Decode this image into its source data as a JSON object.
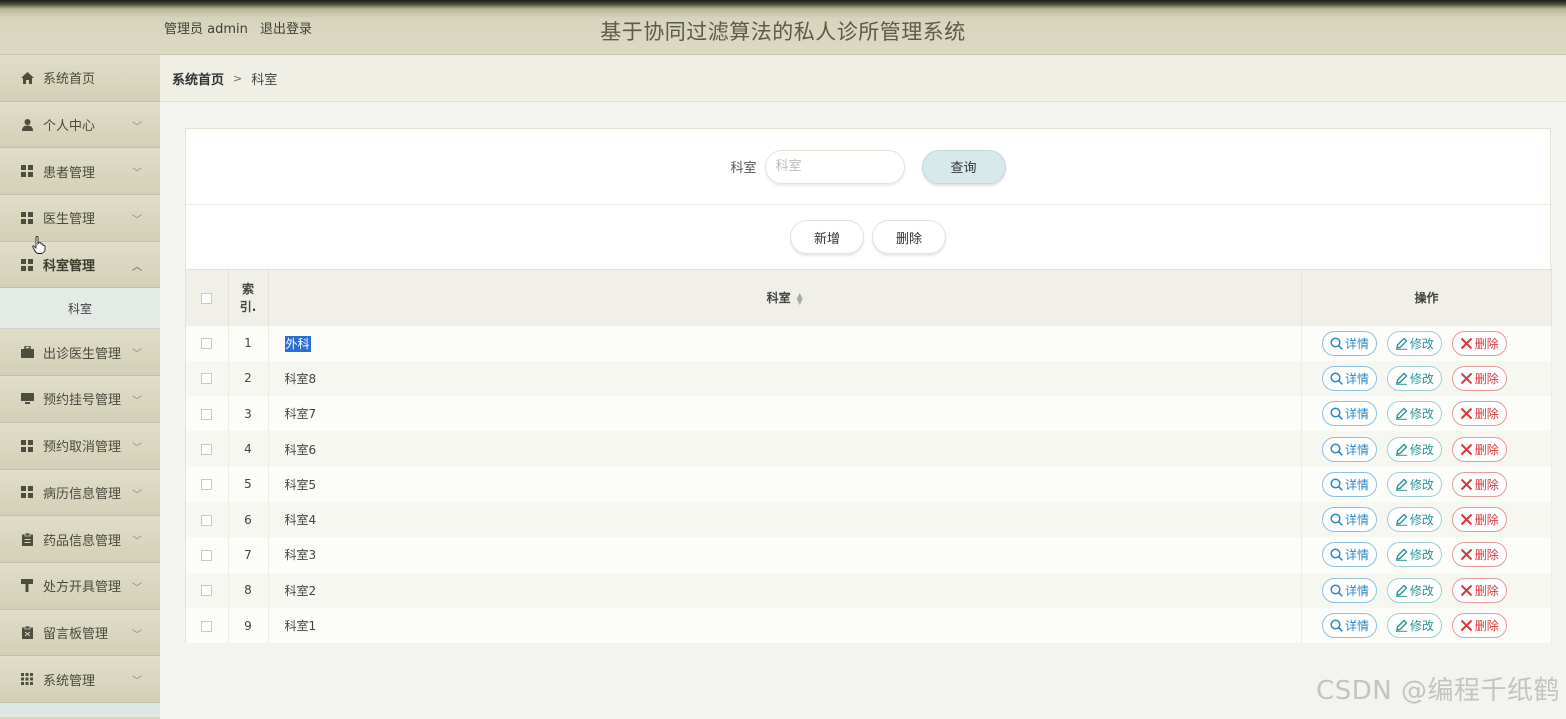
{
  "header": {
    "admin_label": "管理员 admin",
    "logout_label": "退出登录",
    "system_title": "基于协同过滤算法的私人诊所管理系统"
  },
  "sidebar": {
    "items": [
      {
        "label": "系统首页",
        "icon": "home-icon"
      },
      {
        "label": "个人中心",
        "icon": "user-icon"
      },
      {
        "label": "患者管理",
        "icon": "grid-icon"
      },
      {
        "label": "医生管理",
        "icon": "grid-icon"
      },
      {
        "label": "科室管理",
        "icon": "grid-icon"
      },
      {
        "label": "出诊医生管理",
        "icon": "briefcase-icon"
      },
      {
        "label": "预约挂号管理",
        "icon": "monitor-icon"
      },
      {
        "label": "预约取消管理",
        "icon": "grid-icon"
      },
      {
        "label": "病历信息管理",
        "icon": "grid-icon"
      },
      {
        "label": "药品信息管理",
        "icon": "clipboard-icon"
      },
      {
        "label": "处方开具管理",
        "icon": "stamp-icon"
      },
      {
        "label": "留言板管理",
        "icon": "note-icon"
      },
      {
        "label": "系统管理",
        "icon": "apps-icon"
      }
    ],
    "submenu": {
      "label": "科室"
    }
  },
  "breadcrumb": {
    "home": "系统首页",
    "separator": ">",
    "current": "科室"
  },
  "search": {
    "label": "科室",
    "placeholder": "科室",
    "value": "",
    "button": "查询"
  },
  "actions": {
    "add": "新增",
    "delete": "删除"
  },
  "table": {
    "headers": {
      "index": "索引.",
      "name": "科室",
      "operations": "操作"
    },
    "rows": [
      {
        "index": "1",
        "name": "外科"
      },
      {
        "index": "2",
        "name": "科室8"
      },
      {
        "index": "3",
        "name": "科室7"
      },
      {
        "index": "4",
        "name": "科室6"
      },
      {
        "index": "5",
        "name": "科室5"
      },
      {
        "index": "6",
        "name": "科室4"
      },
      {
        "index": "7",
        "name": "科室3"
      },
      {
        "index": "8",
        "name": "科室2"
      },
      {
        "index": "9",
        "name": "科室1"
      }
    ],
    "row_actions": {
      "detail": "详情",
      "edit": "修改",
      "delete": "删除"
    }
  },
  "watermark": "CSDN @编程千纸鹤",
  "colors": {
    "header_bg": "#dcdac4",
    "sidebar_bg": "#d8d6bf",
    "submenu_bg": "#e4ebe6",
    "query_button": "#d7e9eb",
    "detail": "#2b87c7",
    "edit": "#2a9493",
    "delete": "#d43a3a",
    "selection": "#2a6fd6"
  }
}
